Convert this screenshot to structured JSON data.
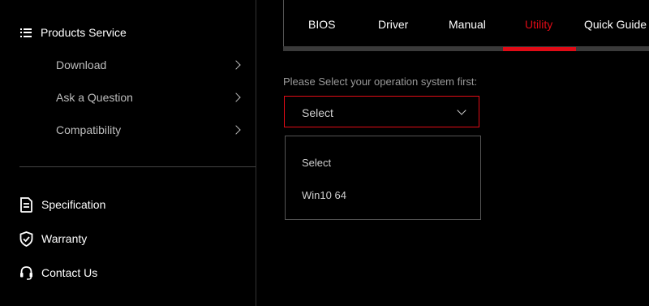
{
  "sidebar": {
    "products_service": "Products Service",
    "sub_items": [
      {
        "label": "Download"
      },
      {
        "label": "Ask a Question"
      },
      {
        "label": "Compatibility"
      }
    ],
    "links": [
      {
        "label": "Specification",
        "icon": "document-icon"
      },
      {
        "label": "Warranty",
        "icon": "shield-check-icon"
      },
      {
        "label": "Contact Us",
        "icon": "headset-icon"
      }
    ]
  },
  "tabs": [
    {
      "label": "BIOS",
      "active": false
    },
    {
      "label": "Driver",
      "active": false
    },
    {
      "label": "Manual",
      "active": false
    },
    {
      "label": "Utility",
      "active": true
    },
    {
      "label": "Quick Guide",
      "active": false
    }
  ],
  "os_select": {
    "label": "Please Select your operation system first:",
    "value": "Select",
    "options": [
      "Select",
      "Win10 64"
    ]
  },
  "colors": {
    "accent": "#e00b16",
    "background": "#000000"
  }
}
